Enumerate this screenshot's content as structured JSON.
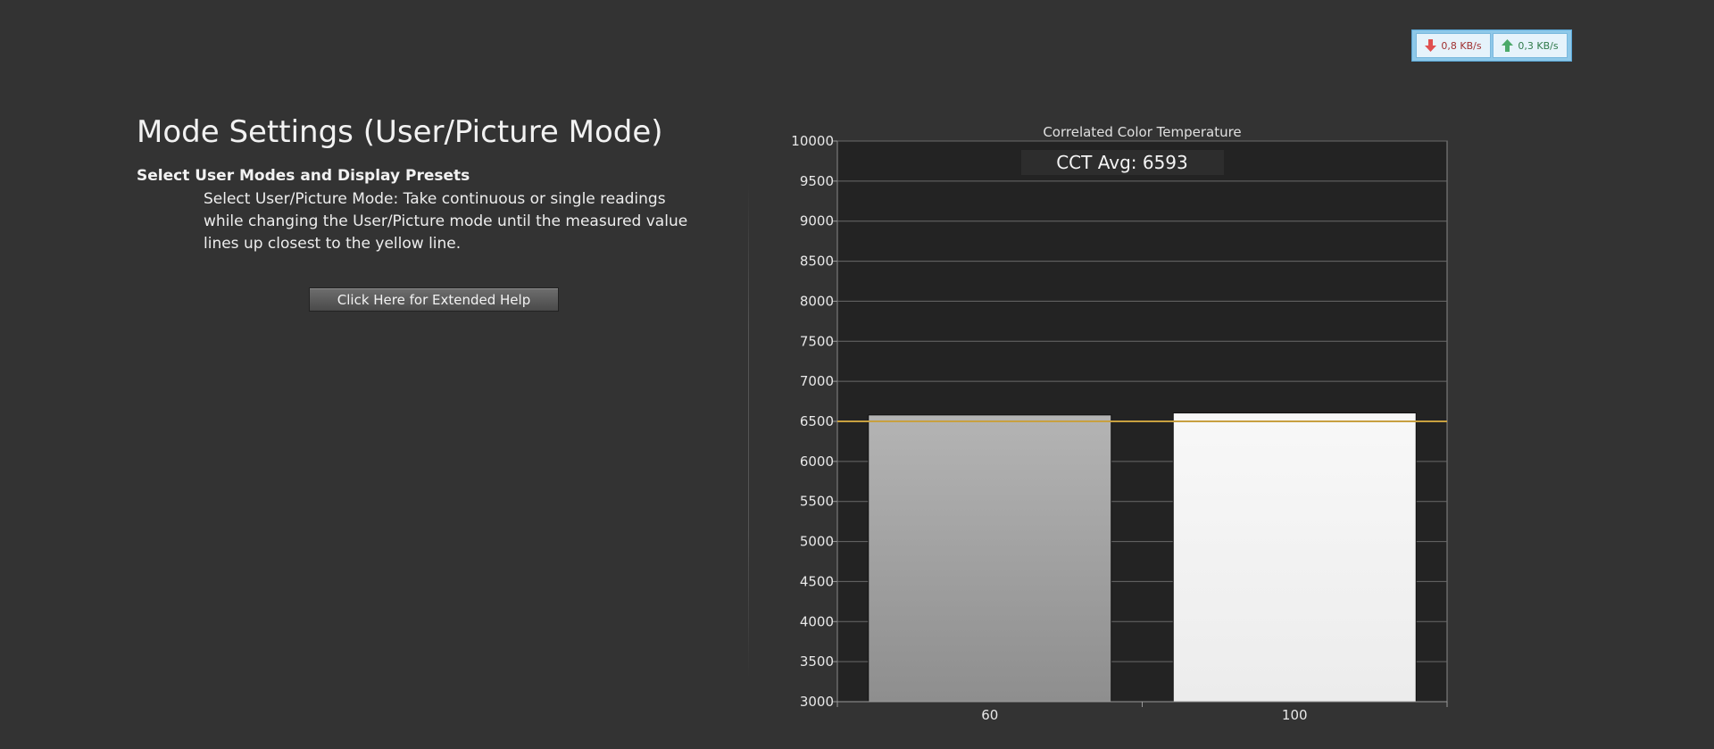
{
  "network": {
    "download": "0,8 KB/s",
    "upload": "0,3 KB/s"
  },
  "panel": {
    "title": "Mode Settings (User/Picture Mode)",
    "subtitle": "Select User Modes and Display Presets",
    "description": "Select User/Picture Mode: Take continuous or single readings while changing the User/Picture mode until the measured value lines up closest to the yellow line.",
    "help_button": "Click Here for Extended Help"
  },
  "colors": {
    "target_line": "#c8a040",
    "bar_60_top": "#b4b4b4",
    "bar_60_bottom": "#8e8e8e",
    "bar_100_top": "#f8f8f8",
    "bar_100_bottom": "#ececec"
  },
  "chart_data": {
    "type": "bar",
    "title": "Correlated Color Temperature",
    "annotation": "CCT Avg: 6593",
    "categories": [
      "60",
      "100"
    ],
    "values": [
      6580,
      6605
    ],
    "target": 6500,
    "ylim": [
      3000,
      10000
    ],
    "yticks": [
      3000,
      3500,
      4000,
      4500,
      5000,
      5500,
      6000,
      6500,
      7000,
      7500,
      8000,
      8500,
      9000,
      9500,
      10000
    ],
    "grid": true,
    "xlabel": "",
    "ylabel": ""
  }
}
